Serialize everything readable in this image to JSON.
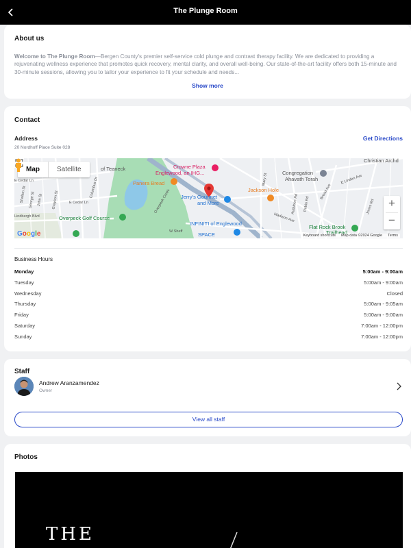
{
  "header": {
    "title": "The Plunge Room"
  },
  "about": {
    "heading": "About us",
    "business_name": "Welcome to The Plunge Room",
    "text": "—Bergen County's premier self-service cold plunge and contrast therapy facility. We are dedicated to providing a rejuvenating wellness experience that promotes quick recovery, mental clarity, and overall well-being. Our state-of-the-art facility offers both 15-minute and 30-minute sessions, allowing you to tailor your experience to fit your schedule and needs...",
    "show_more": "Show more"
  },
  "contact": {
    "heading": "Contact",
    "address_label": "Address",
    "address": "20 Nordhoff Place Suite 028",
    "directions": "Get Directions",
    "map": {
      "map_tab": "Map",
      "satellite_tab": "Satellite",
      "zoom_in": "+",
      "zoom_out": "−",
      "google": "Google",
      "shortcuts": "Keyboard shortcuts",
      "copyright": "Map data ©2024 Google",
      "terms": "Terms",
      "places": {
        "teaneck": "of Teaneck",
        "crowne": "Crowne Plaza",
        "crowne2": "Englewood, an IHG...",
        "panera": "Panera Bread",
        "jerrys": "Jerry's Gourmet",
        "jerrys2": "and More",
        "jackson": "Jackson Hole",
        "congregation": "Congregation",
        "ahavath": "Ahavath Torah",
        "christian": "Christian Archd",
        "golf": "Overpeck Golf Course",
        "infiniti": "INFINITI of Englewood",
        "space": "SPACE",
        "flatrock": "Flat Rock Brook",
        "trailhead": "Trailhead"
      },
      "streets": {
        "cedar": "E Cedar Ln",
        "cedar2": "E Cedar Ln",
        "lindbergh": "Lindbergh Blvd",
        "columbus": "Columbus Dr",
        "overpeck": "Overpeck Creek",
        "madison": "Madison Ave",
        "broad": "Broad Ave",
        "jones": "Jones Rd",
        "linden": "E Linden Ave",
        "mary": "Mary St",
        "audubon": "Audubon Rd",
        "robin": "Robin Rd",
        "sheff": "W Sheff",
        "pegan": "Pegan Rd",
        "george": "George St",
        "john": "John St",
        "shelton": "Shelton St",
        "grayson": "Grayson St",
        "new": "New St"
      }
    },
    "hours_heading": "Business Hours",
    "hours": [
      {
        "day": "Monday",
        "time": "5:00am - 9:00am"
      },
      {
        "day": "Tuesday",
        "time": "5:00am - 9:00am"
      },
      {
        "day": "Wednesday",
        "time": "Closed"
      },
      {
        "day": "Thursday",
        "time": "5:00am - 9:05am"
      },
      {
        "day": "Friday",
        "time": "5:00am - 9:00am"
      },
      {
        "day": "Saturday",
        "time": "7:00am - 12:00pm"
      },
      {
        "day": "Sunday",
        "time": "7:00am - 12:00pm"
      }
    ]
  },
  "staff": {
    "heading": "Staff",
    "members": [
      {
        "name": "Andrew Aranzamendez",
        "role": "Owner"
      }
    ],
    "view_all": "View all staff"
  },
  "photos": {
    "heading": "Photos",
    "photo_text": "THE"
  },
  "colors": {
    "accent": "#2848c8",
    "background": "#f0f1f3",
    "header": "#000000",
    "pin": "#e53935"
  }
}
